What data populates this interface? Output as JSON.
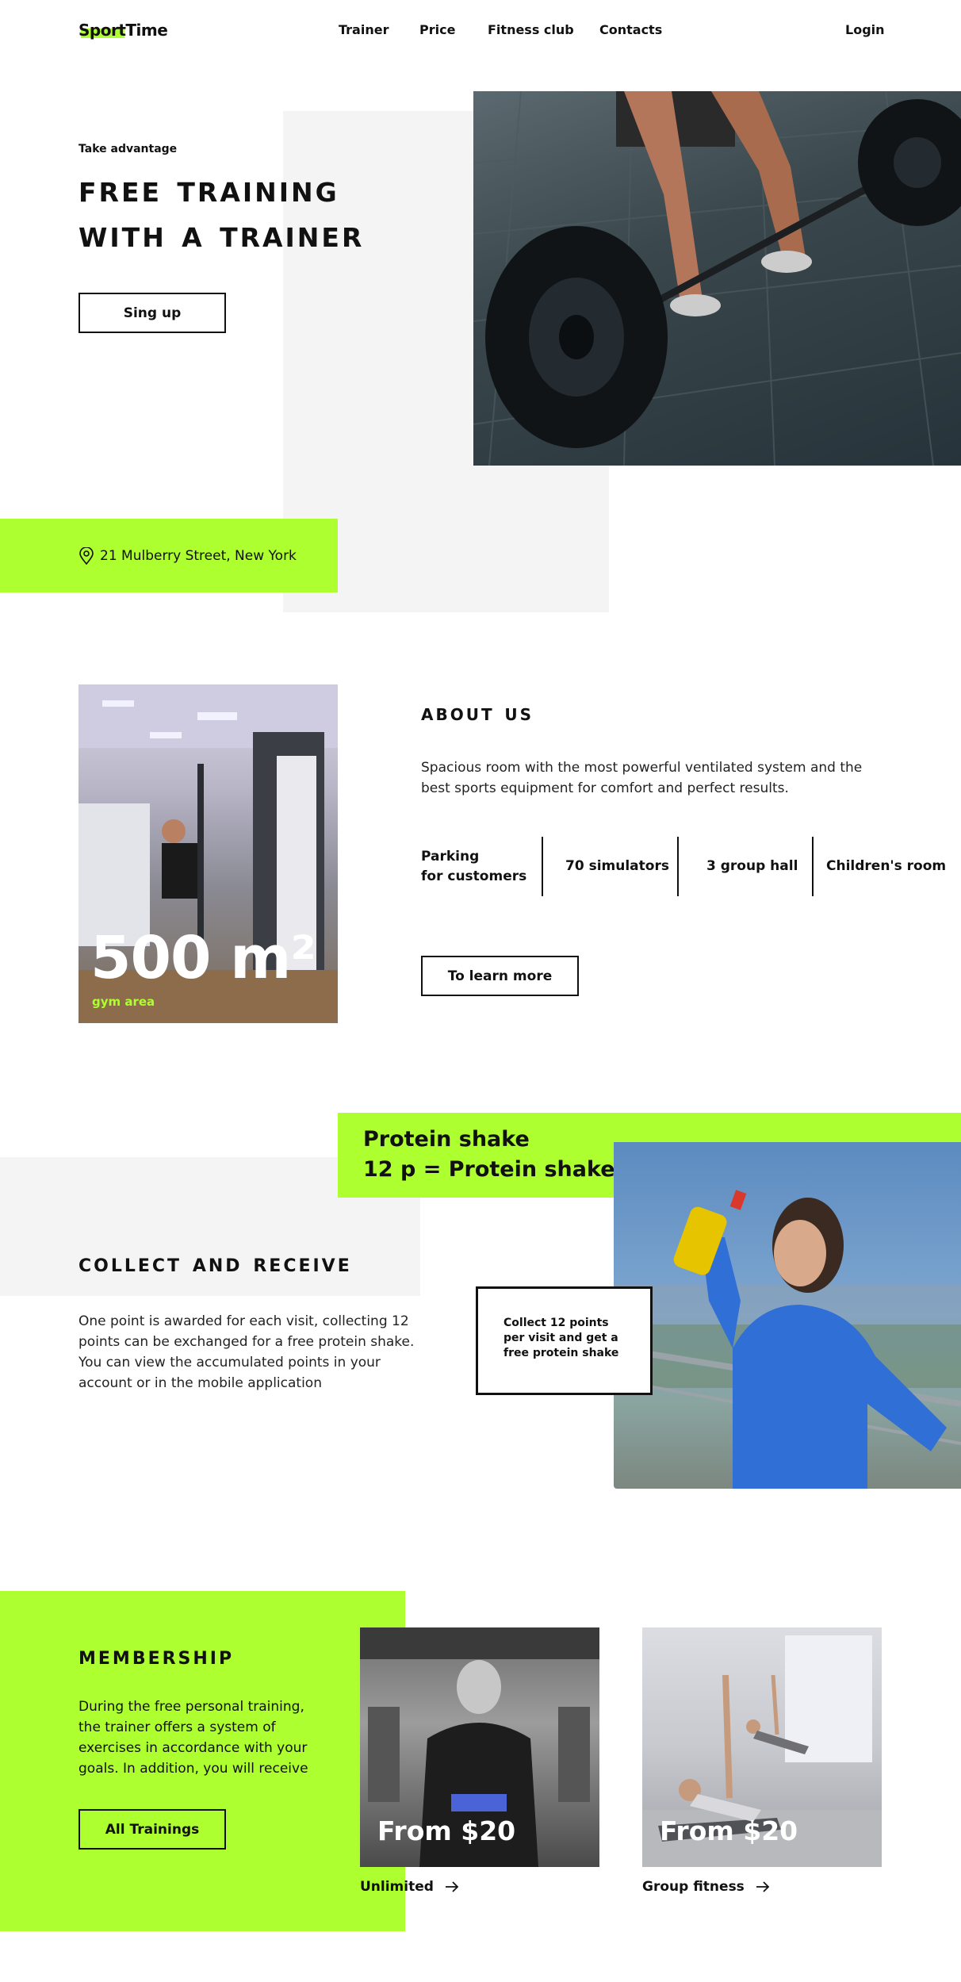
{
  "header": {
    "logo": "SportTime",
    "nav": [
      "Trainer",
      "Price",
      "Fitness club",
      "Contacts"
    ],
    "login": "Login"
  },
  "hero": {
    "kicker": "Take advantage",
    "title_line1": "Free Training",
    "title_line2": "with a Trainer",
    "cta": "Sing up",
    "address": "21 Mulberry Street, New York"
  },
  "about": {
    "area_value": "500 m²",
    "area_label": "gym area",
    "title": "About us",
    "text": "Spacious room with the most powerful ventilated system  and the best sports equipment for comfort  and perfect results.",
    "features": {
      "parking_line1": "Parking",
      "parking_line2": "for customers",
      "simulators": "70 simulators",
      "group_hall": "3 group hall",
      "childrens_room": "Children's room"
    },
    "cta": "To learn more"
  },
  "promo": {
    "headline_line1": "Protein shake",
    "headline_line2": "12 p = Protein shake",
    "title": "Collect and receive",
    "text": "One point is awarded for each visit, collecting 12 points can be exchanged for a free protein shake. You can view the accumulated points in your account or in the mobile application",
    "box_text": "Collect 12 points per visit and get a free protein shake"
  },
  "membership": {
    "title": "Membership",
    "text": "During the free personal training, the trainer offers a system of exercises in accordance with your goals. In addition, you will receive",
    "cta": "All Trainings",
    "cards": [
      {
        "price": "From $20",
        "label": "Unlimited"
      },
      {
        "price": "From $20",
        "label": "Group fitness"
      }
    ]
  },
  "colors": {
    "accent": "#adff2f",
    "panel": "#f4f4f4",
    "text": "#111111"
  }
}
